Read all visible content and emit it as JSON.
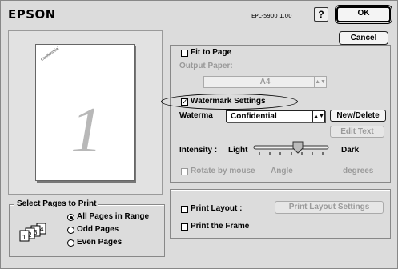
{
  "header": {
    "brand": "EPSON",
    "model": "EPL-5900  1.00",
    "help_label": "?",
    "ok_label": "OK",
    "cancel_label": "Cancel"
  },
  "preview": {
    "page_number": "1",
    "watermark_text": "Confidential"
  },
  "fit_to_page": {
    "label": "Fit to Page",
    "checked": false,
    "output_paper_label": "Output Paper:",
    "output_paper_value": "A4"
  },
  "watermark": {
    "settings_label": "Watermark Settings",
    "checked": true,
    "field_label": "Waterma",
    "selected": "Confidential",
    "new_delete_label": "New/Delete",
    "edit_text_label": "Edit Text",
    "intensity_label": "Intensity :",
    "intensity_low": "Light",
    "intensity_high": "Dark",
    "intensity_level_fraction": 0.5,
    "rotate_label": "Rotate by mouse",
    "angle_label": "Angle",
    "degrees_label": "degrees"
  },
  "layout": {
    "print_layout_label": "Print Layout :",
    "print_layout_settings_label": "Print Layout Settings",
    "print_frame_label": "Print the Frame"
  },
  "pages": {
    "title": "Select Pages to Print",
    "options": [
      "All Pages in Range",
      "Odd Pages",
      "Even Pages"
    ],
    "selected_index": 0,
    "icon_numbers": [
      "1",
      "2",
      "3",
      "4"
    ]
  }
}
